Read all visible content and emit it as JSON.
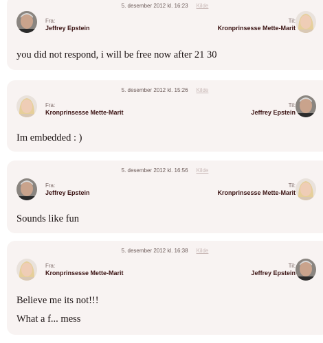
{
  "labels": {
    "from": "Fra:",
    "to": "Til:",
    "source": "Kilde"
  },
  "messages": [
    {
      "timestamp": "5. desember 2012 kl. 16:23",
      "from": "Jeffrey Epstein",
      "to": "Kronprinsesse Mette-Marit",
      "lines": [
        "you did not respond, i will be free now after 21 30"
      ]
    },
    {
      "timestamp": "5. desember 2012 kl. 15:26",
      "from": "Kronprinsesse Mette-Marit",
      "to": "Jeffrey Epstein",
      "lines": [
        "Im embedded : )"
      ]
    },
    {
      "timestamp": "5. desember 2012 kl. 16:56",
      "from": "Jeffrey Epstein",
      "to": "Kronprinsesse Mette-Marit",
      "lines": [
        "Sounds like fun"
      ]
    },
    {
      "timestamp": "5. desember 2012 kl. 16:38",
      "from": "Kronprinsesse Mette-Marit",
      "to": "Jeffrey Epstein",
      "lines": [
        "Believe me its not!!!",
        "What a f... mess"
      ]
    }
  ],
  "colors": {
    "card": "#f8f3f2",
    "name": "#3a1212",
    "link": "#c9b9b7"
  }
}
